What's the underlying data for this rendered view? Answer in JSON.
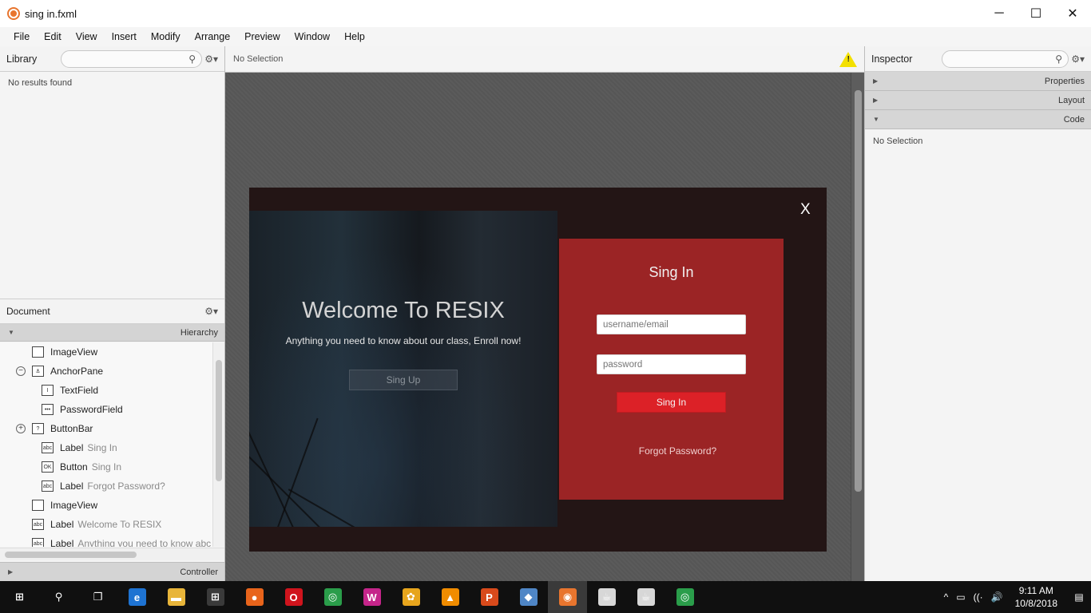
{
  "window": {
    "title": "sing in.fxml",
    "minimize": "─",
    "maximize": "☐",
    "close": "✕"
  },
  "menu": [
    "File",
    "Edit",
    "View",
    "Insert",
    "Modify",
    "Arrange",
    "Preview",
    "Window",
    "Help"
  ],
  "library": {
    "label": "Library",
    "search_placeholder": "",
    "empty_text": "No results found"
  },
  "document": {
    "label": "Document",
    "hierarchy_label": "Hierarchy",
    "controller_label": "Controller",
    "tree": [
      {
        "icon": "imageview-icon",
        "glyph": "",
        "label": "ImageView",
        "sub": "",
        "indent": 1,
        "expander": ""
      },
      {
        "icon": "anchorpane-icon",
        "glyph": "⚓",
        "label": "AnchorPane",
        "sub": "",
        "indent": 0,
        "expander": "−"
      },
      {
        "icon": "textfield-icon",
        "glyph": "I",
        "label": "TextField",
        "sub": "",
        "indent": 2,
        "expander": ""
      },
      {
        "icon": "passwordfield-icon",
        "glyph": "•••",
        "label": "PasswordField",
        "sub": "",
        "indent": 2,
        "expander": ""
      },
      {
        "icon": "buttonbar-icon",
        "glyph": "?",
        "label": "ButtonBar",
        "sub": "",
        "indent": 0,
        "expander": "+"
      },
      {
        "icon": "label-icon",
        "glyph": "abc",
        "label": "Label",
        "sub": "Sing In",
        "indent": 2,
        "expander": ""
      },
      {
        "icon": "button-icon",
        "glyph": "OK",
        "label": "Button",
        "sub": "Sing In",
        "indent": 2,
        "expander": ""
      },
      {
        "icon": "label-icon",
        "glyph": "abc",
        "label": "Label",
        "sub": "Forgot Password?",
        "indent": 2,
        "expander": ""
      },
      {
        "icon": "imageview-icon",
        "glyph": "",
        "label": "ImageView",
        "sub": "",
        "indent": 1,
        "expander": ""
      },
      {
        "icon": "label-icon",
        "glyph": "abc",
        "label": "Label",
        "sub": "Welcome To RESIX",
        "indent": 1,
        "expander": ""
      },
      {
        "icon": "label-icon",
        "glyph": "abc",
        "label": "Label",
        "sub": "Anything you need to know abc",
        "indent": 1,
        "expander": ""
      }
    ]
  },
  "center": {
    "selection_text": "No Selection",
    "warning_glyph": "!"
  },
  "scene": {
    "close": "X",
    "welcome": "Welcome To RESIX",
    "tagline": "Anything you need to know about our class, Enroll now!",
    "signup_label": "Sing Up",
    "card_title": "Sing In",
    "username_placeholder": "username/email",
    "password_placeholder": "password",
    "signin_label": "Sing In",
    "forgot_label": "Forgot Password?",
    "colors": {
      "card": "#9b2425",
      "button": "#dc2127",
      "background": "#231515"
    }
  },
  "inspector": {
    "label": "Inspector",
    "sections": [
      {
        "label": "Properties",
        "arrow": "▶"
      },
      {
        "label": "Layout",
        "arrow": "▶"
      },
      {
        "label": "Code",
        "arrow": "▼"
      }
    ],
    "selection_text": "No Selection"
  },
  "taskbar": {
    "apps": [
      {
        "name": "start-icon",
        "glyph": "⊞",
        "color": "#101010"
      },
      {
        "name": "search-icon",
        "glyph": "⚲",
        "color": "#101010"
      },
      {
        "name": "task-view-icon",
        "glyph": "❐",
        "color": "#101010"
      },
      {
        "name": "edge-icon",
        "glyph": "e",
        "color": "#1e73d2"
      },
      {
        "name": "file-explorer-icon",
        "glyph": "▬",
        "color": "#e8b53a"
      },
      {
        "name": "store-icon",
        "glyph": "⊞",
        "color": "#3a3a3a"
      },
      {
        "name": "firefox-icon",
        "glyph": "●",
        "color": "#e8641b"
      },
      {
        "name": "opera-icon",
        "glyph": "O",
        "color": "#d0141d"
      },
      {
        "name": "chrome-icon",
        "glyph": "◎",
        "color": "#2a9d4a"
      },
      {
        "name": "wamp-icon",
        "glyph": "W",
        "color": "#c5258a"
      },
      {
        "name": "app-icon-yellow",
        "glyph": "✿",
        "color": "#e7a51d"
      },
      {
        "name": "vlc-icon",
        "glyph": "▲",
        "color": "#f08c00"
      },
      {
        "name": "office-icon",
        "glyph": "P",
        "color": "#d84a1b"
      },
      {
        "name": "virtualbox-icon",
        "glyph": "◆",
        "color": "#4f86c6"
      },
      {
        "name": "scene-builder-icon",
        "glyph": "◉",
        "color": "#e8752e"
      },
      {
        "name": "java-icon",
        "glyph": "☕",
        "color": "#d7d7d7"
      },
      {
        "name": "java-icon-2",
        "glyph": "☕",
        "color": "#d7d7d7"
      },
      {
        "name": "chrome-icon-2",
        "glyph": "◎",
        "color": "#2a9d4a"
      }
    ],
    "active_index": 14,
    "tray": [
      "^",
      "▭",
      "((·",
      "🔊"
    ],
    "time": "9:11 AM",
    "date": "10/8/2018"
  }
}
